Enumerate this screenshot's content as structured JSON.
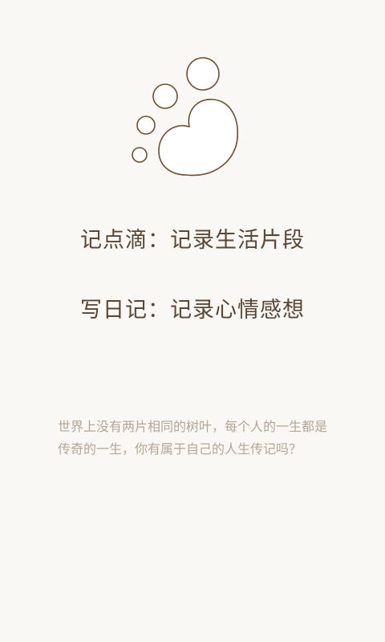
{
  "app": {
    "logo_icon": "paw-heart-icon",
    "accent_color": "#6b4f2f",
    "background_color": "#f9f8f5"
  },
  "headlines": [
    {
      "text": "记点滴：记录生活片段"
    },
    {
      "text": "写日记：记录心情感想"
    }
  ],
  "tagline": {
    "line1": "世界上没有两片相同的树叶，每个人的一生都是",
    "line2": "传奇的一生，你有属于自己的人生传记吗？"
  }
}
